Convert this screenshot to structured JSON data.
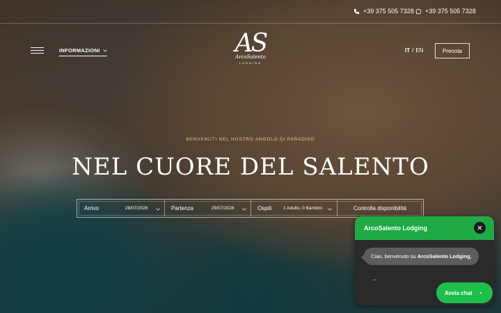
{
  "topbar": {
    "phone_call": "+39 375 505 7328",
    "phone_whatsapp": "+39 375 505 7328"
  },
  "header": {
    "menu_label": "INFORMAZIONI",
    "logo": {
      "mark": "AS",
      "script": "ArcoSalento",
      "sub": "LODGING"
    },
    "lang_it": "IT",
    "lang_sep": "/",
    "lang_en": "EN",
    "book_label": "Prenota"
  },
  "hero": {
    "eyebrow": "BENVENUTI NEL NOSTRO ANGOLO DI PARADISO",
    "title": "NEL CUORE DEL SALENTO"
  },
  "booking": {
    "arrival_label": "Arrivo",
    "arrival_value": "28/07/2026",
    "departure_label": "Partenza",
    "departure_value": "29/07/2026",
    "guests_label": "Ospiti",
    "guests_value": "1 Adulto, 0 Bambini",
    "check_label": "Controlla disponibilità"
  },
  "chat": {
    "title": "ArcoSalento Lodging",
    "greeting": "Ciao, benvenuto su ",
    "greeting_brand": "ArcoSalento Lodging,",
    "start_label": "Avvia chat"
  },
  "colors": {
    "accent_gold": "#e2c79a",
    "chat_green": "#1faa45",
    "chat_button": "#1fbf4e"
  }
}
